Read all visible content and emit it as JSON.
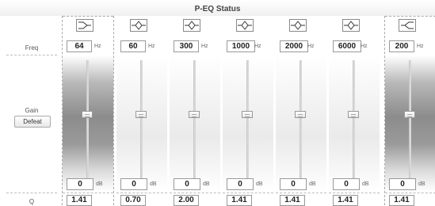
{
  "title": "P-EQ Status",
  "labels": {
    "freq": "Freq",
    "gain": "Gain",
    "defeat": "Defeat",
    "q": "Q"
  },
  "units": {
    "freq": "Hz",
    "gain": "dB"
  },
  "bands": [
    {
      "type": "low-shelf",
      "icon": "low-shelf-icon",
      "freq": "64",
      "gain": "0",
      "q": "1.41"
    },
    {
      "type": "peaking",
      "icon": "peaking-icon",
      "freq": "60",
      "gain": "0",
      "q": "0.70"
    },
    {
      "type": "peaking",
      "icon": "peaking-icon",
      "freq": "300",
      "gain": "0",
      "q": "2.00"
    },
    {
      "type": "peaking",
      "icon": "peaking-icon",
      "freq": "1000",
      "gain": "0",
      "q": "1.41"
    },
    {
      "type": "peaking",
      "icon": "peaking-icon",
      "freq": "2000",
      "gain": "0",
      "q": "1.41"
    },
    {
      "type": "peaking",
      "icon": "peaking-icon",
      "freq": "6000",
      "gain": "0",
      "q": "1.41"
    },
    {
      "type": "high-shelf",
      "icon": "high-shelf-icon",
      "freq": "200",
      "gain": "0",
      "q": "1.41"
    }
  ]
}
